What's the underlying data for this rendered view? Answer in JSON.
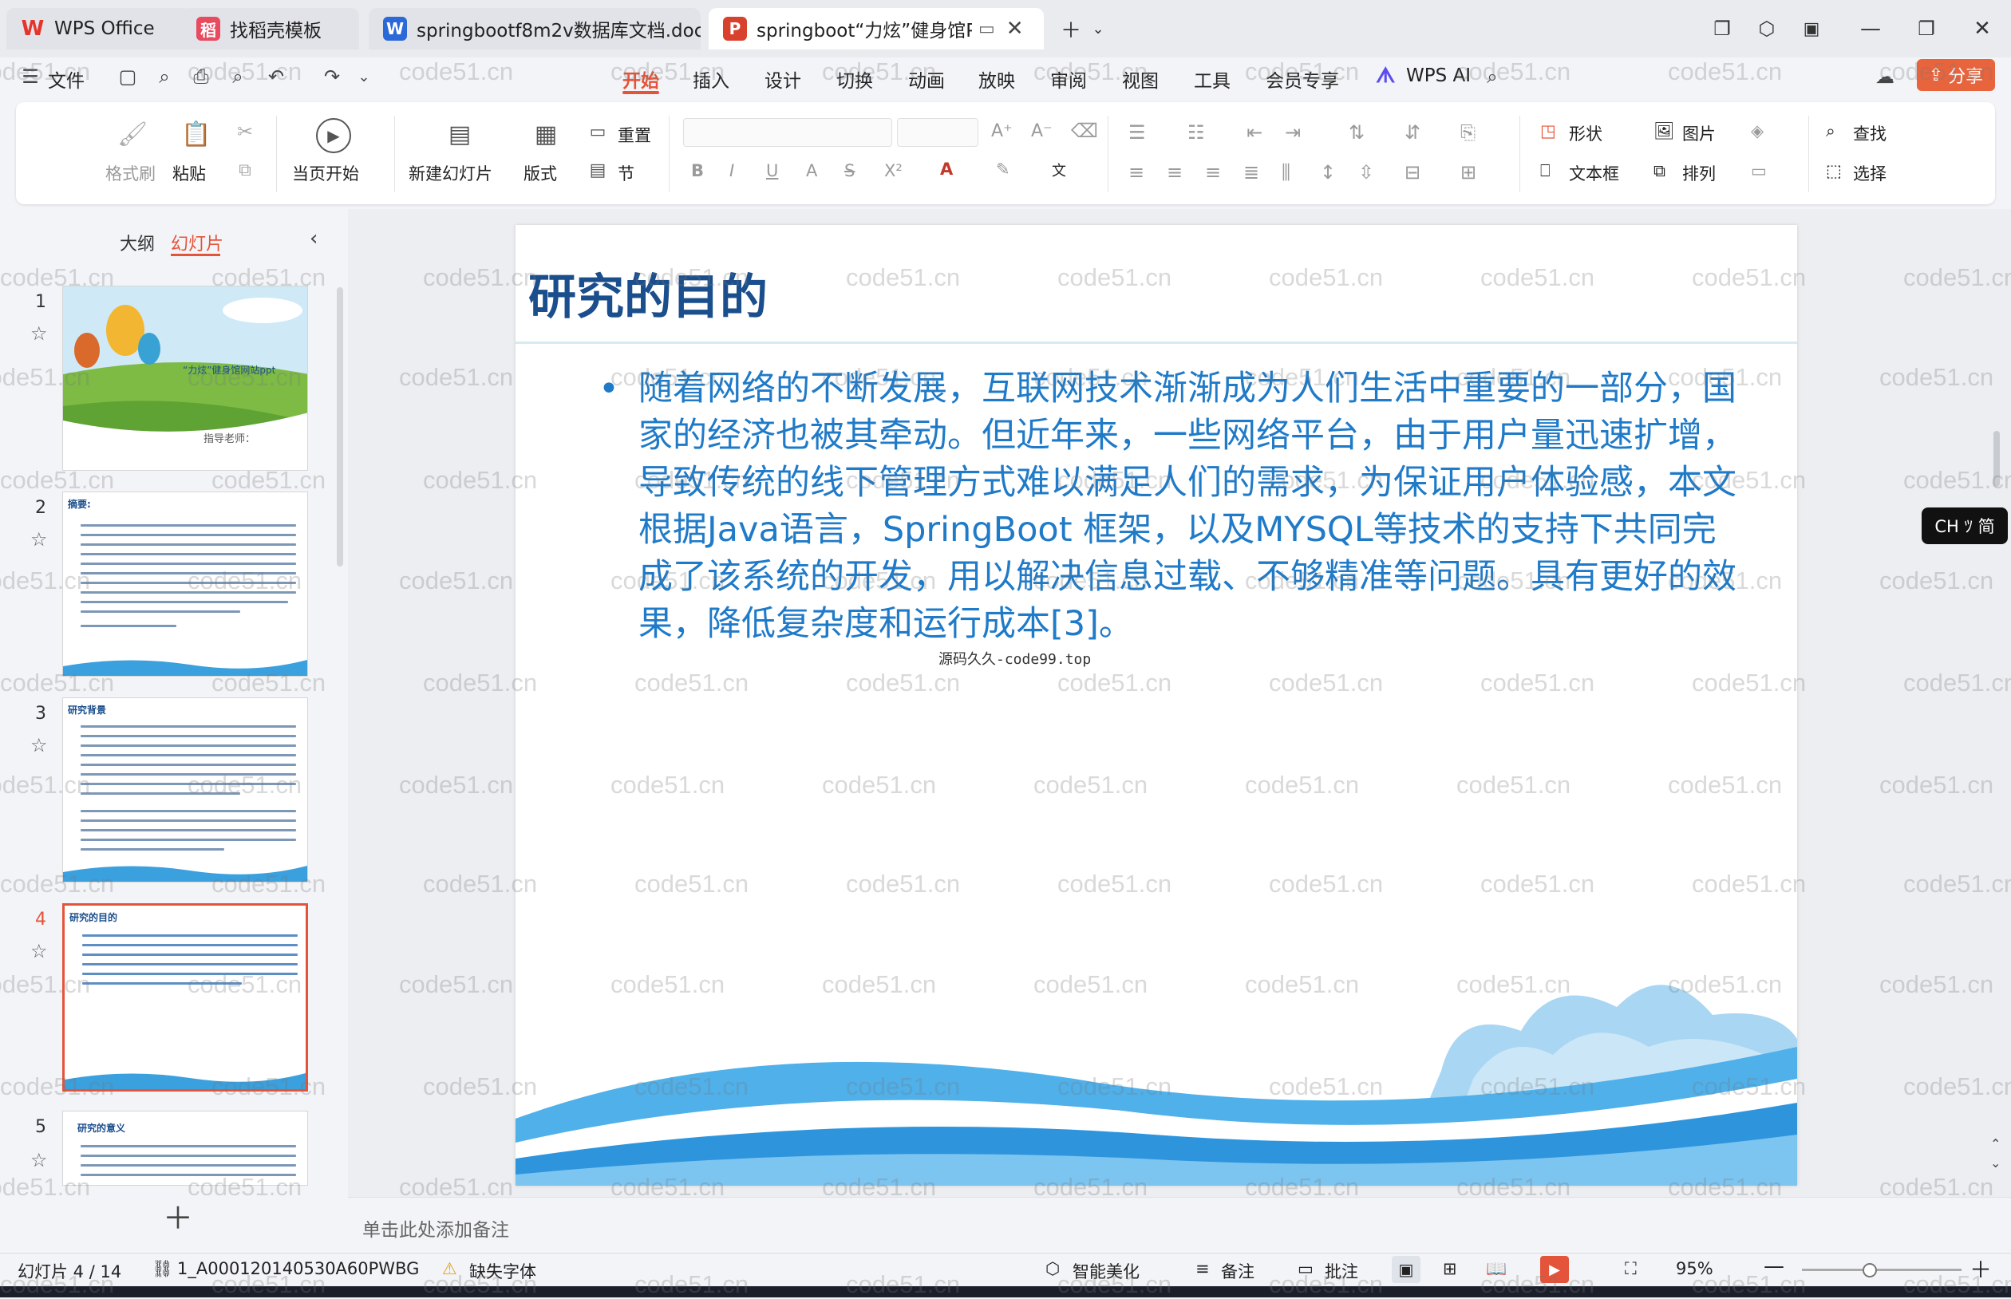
{
  "tabs": [
    {
      "label": "WPS Office",
      "icon": "W",
      "icon_color": "#e5352b"
    },
    {
      "label": "找稻壳模板",
      "icon": "稻",
      "icon_color": "#e84a5f"
    },
    {
      "label": "springbootf8m2v数据库文档.doc",
      "icon": "W",
      "icon_color": "#2b68d8"
    },
    {
      "label": "springboot“力炫”健身馆P",
      "icon": "P",
      "icon_color": "#d9412f"
    }
  ],
  "menu": {
    "file": "文件",
    "items": [
      "开始",
      "插入",
      "设计",
      "切换",
      "动画",
      "放映",
      "审阅",
      "视图",
      "工具",
      "会员专享"
    ],
    "active": "开始",
    "wps_ai": "WPS AI",
    "share": "分享"
  },
  "ribbon": {
    "format_brush": "格式刷",
    "paste": "粘贴",
    "from_current": "当页开始",
    "new_slide": "新建幻灯片",
    "layout": "版式",
    "section": "节",
    "reset": "重置",
    "shape": "形状",
    "picture": "图片",
    "find": "查找",
    "textbox": "文本框",
    "arrange": "排列",
    "select": "选择"
  },
  "panel": {
    "outline_tab": "大纲",
    "slides_tab": "幻灯片",
    "thumbs": [
      {
        "num": "1",
        "title": "“力炫”健身馆网站ppt",
        "sub": "指导老师："
      },
      {
        "num": "2",
        "title": "摘要:"
      },
      {
        "num": "3",
        "title": "研究背景"
      },
      {
        "num": "4",
        "title": "研究的目的"
      },
      {
        "num": "5",
        "title": "研究的意义"
      }
    ],
    "selected": "4"
  },
  "slide": {
    "title": "研究的目的",
    "body": "随着网络的不断发展，互联网技术渐渐成为人们生活中重要的一部分，国家的经济也被其牵动。但近年来，一些网络平台，由于用户量迅速扩增，导致传统的线下管理方式难以满足人们的需求，为保证用户体验感，本文根据Java语言，SpringBoot 框架，以及MYSQL等技术的支持下共同完成了该系统的开发，用以解决信息过载、不够精准等问题。具有更好的效果，降低复杂度和运行成本[3]。",
    "source_watermark": "源码久久-code99.top"
  },
  "notes_placeholder": "单击此处添加备注",
  "status": {
    "slide_counter": "幻灯片 4 / 14",
    "template_name": "1_A000120140530A60PWBG",
    "missing_font": "缺失字体",
    "smart_beautify": "智能美化",
    "notes": "备注",
    "comments": "批注",
    "zoom": "95%"
  },
  "ime": "CH ﾂ 简",
  "watermark": "code51.cn",
  "colors": {
    "accent": "#e4543a",
    "slide_text": "#1f7ac8",
    "slide_title": "#1a4e8c"
  }
}
